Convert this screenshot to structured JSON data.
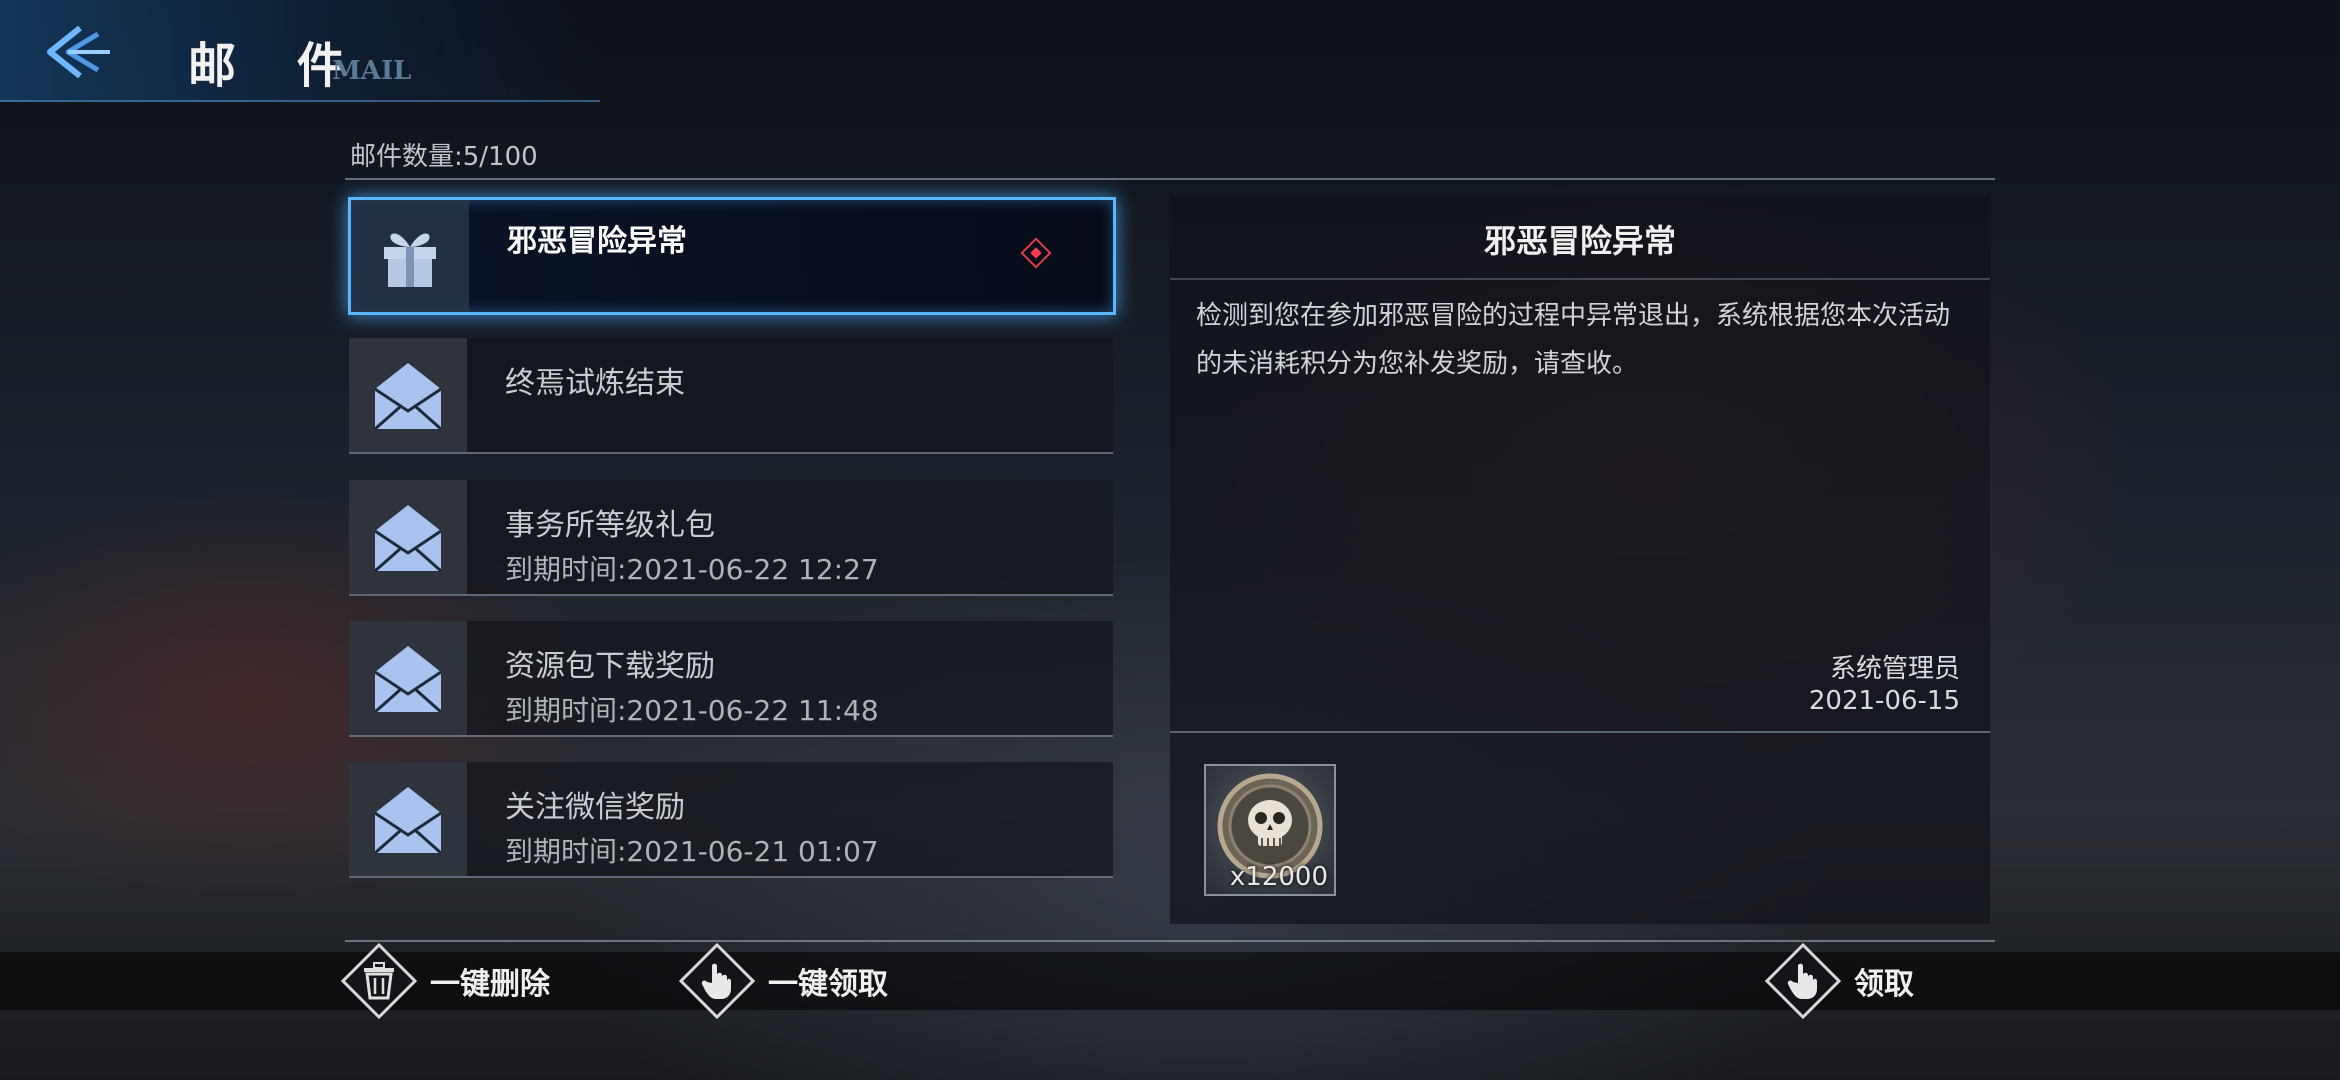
{
  "header": {
    "title": "邮 件",
    "title_en": "MAIL",
    "accent_color": "#3a8fe0"
  },
  "mail_count": "邮件数量:5/100",
  "mails": [
    {
      "subject": "邪恶冒险异常",
      "expire": "",
      "icon": "gift-icon",
      "selected": true,
      "unread": true
    },
    {
      "subject": "终焉试炼结束",
      "expire": "",
      "icon": "envelope-icon",
      "selected": false,
      "unread": false
    },
    {
      "subject": "事务所等级礼包",
      "expire": "到期时间:2021-06-22 12:27",
      "icon": "envelope-icon",
      "selected": false,
      "unread": false
    },
    {
      "subject": "资源包下载奖励",
      "expire": "到期时间:2021-06-22 11:48",
      "icon": "envelope-icon",
      "selected": false,
      "unread": false
    },
    {
      "subject": "关注微信奖励",
      "expire": "到期时间:2021-06-21 01:07",
      "icon": "envelope-icon",
      "selected": false,
      "unread": false
    }
  ],
  "detail": {
    "title": "邪恶冒险异常",
    "body": "检测到您在参加邪恶冒险的过程中异常退出，系统根据您本次活动的未消耗积分为您补发奖励，请查收。",
    "sender": "系统管理员",
    "date": "2021-06-15",
    "reward": {
      "icon": "skull-coin-icon",
      "count": "x12000"
    }
  },
  "actions": {
    "delete_all": "一键删除",
    "claim_all": "一键领取",
    "claim": "领取"
  }
}
